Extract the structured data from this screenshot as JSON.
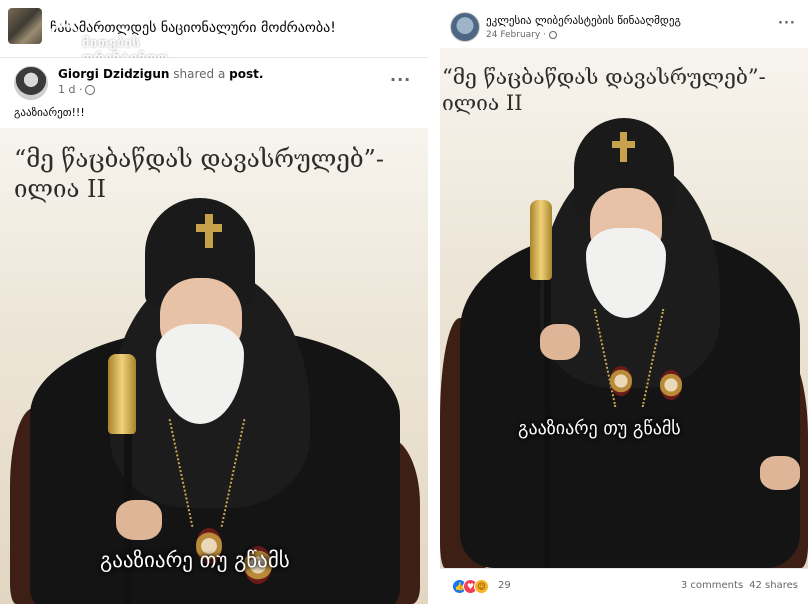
{
  "left_post": {
    "group_name": "ჩასამართლდეს ნაციონალური მოძრაობა!",
    "watermark_text": "მითების\nფრენტინფო",
    "author_name": "Giorgi Dzidzigun",
    "action_text": " shared a ",
    "action_object": "post.",
    "time": "1 d ·",
    "more_label": "···",
    "caption": "გააზიარეთ!!!",
    "image": {
      "quote_line1": "“მე წაცბაწდას დავასრულებ”-",
      "quote_line2": "ილია II",
      "subtitle": "გააზიარე თუ გწამს"
    }
  },
  "right_post": {
    "page_name": "ეკლესია ლიბერასტების წინააღმდეგ",
    "time": "24 February ·",
    "more_label": "···",
    "image": {
      "quote_line1": "“მე წაცბაწდას დავასრულებ”-",
      "quote_line2": "ილია II",
      "subtitle": "გააზიარე თუ გწამს"
    },
    "reactions": {
      "icons": [
        "like-icon",
        "love-icon",
        "haha-icon"
      ],
      "count": "29",
      "comments": "3 comments",
      "shares": "42 shares"
    }
  },
  "colors": {
    "secondary_text": "#65676b",
    "like_blue": "#1877f2",
    "love_red": "#f33e58",
    "haha_yellow": "#f7b125"
  }
}
